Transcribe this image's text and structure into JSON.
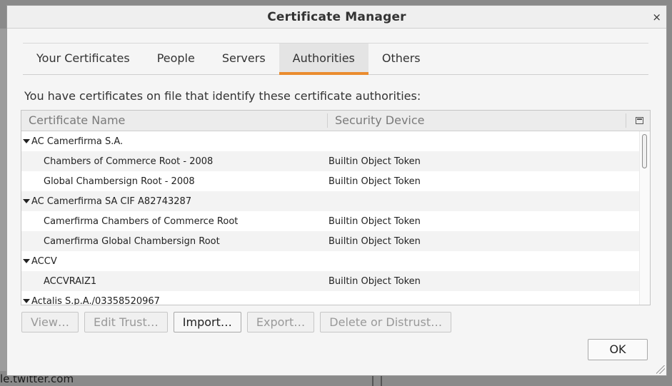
{
  "background": {
    "bottom_text": "le.twitter.com"
  },
  "dialog": {
    "title": "Certificate Manager",
    "close_glyph": "×",
    "tabs": [
      {
        "label": "Your Certificates",
        "active": false
      },
      {
        "label": "People",
        "active": false
      },
      {
        "label": "Servers",
        "active": false
      },
      {
        "label": "Authorities",
        "active": true
      },
      {
        "label": "Others",
        "active": false
      }
    ],
    "description": "You have certificates on file that identify these certificate authorities:",
    "tree": {
      "columns": {
        "name": "Certificate Name",
        "device": "Security Device"
      },
      "rows": [
        {
          "type": "group",
          "name": "AC Camerfirma S.A.",
          "device": ""
        },
        {
          "type": "child",
          "name": "Chambers of Commerce Root - 2008",
          "device": "Builtin Object Token"
        },
        {
          "type": "child",
          "name": "Global Chambersign Root - 2008",
          "device": "Builtin Object Token"
        },
        {
          "type": "group",
          "name": "AC Camerfirma SA CIF A82743287",
          "device": ""
        },
        {
          "type": "child",
          "name": "Camerfirma Chambers of Commerce Root",
          "device": "Builtin Object Token"
        },
        {
          "type": "child",
          "name": "Camerfirma Global Chambersign Root",
          "device": "Builtin Object Token"
        },
        {
          "type": "group",
          "name": "ACCV",
          "device": ""
        },
        {
          "type": "child",
          "name": "ACCVRAIZ1",
          "device": "Builtin Object Token"
        },
        {
          "type": "group",
          "name": "Actalis S.p.A./03358520967",
          "device": ""
        }
      ]
    },
    "buttons": {
      "view": "View…",
      "edit_trust": "Edit Trust…",
      "import": "Import…",
      "export": "Export…",
      "delete": "Delete or Distrust…"
    },
    "ok": "OK"
  },
  "colors": {
    "accent": "#ea8c2e"
  }
}
